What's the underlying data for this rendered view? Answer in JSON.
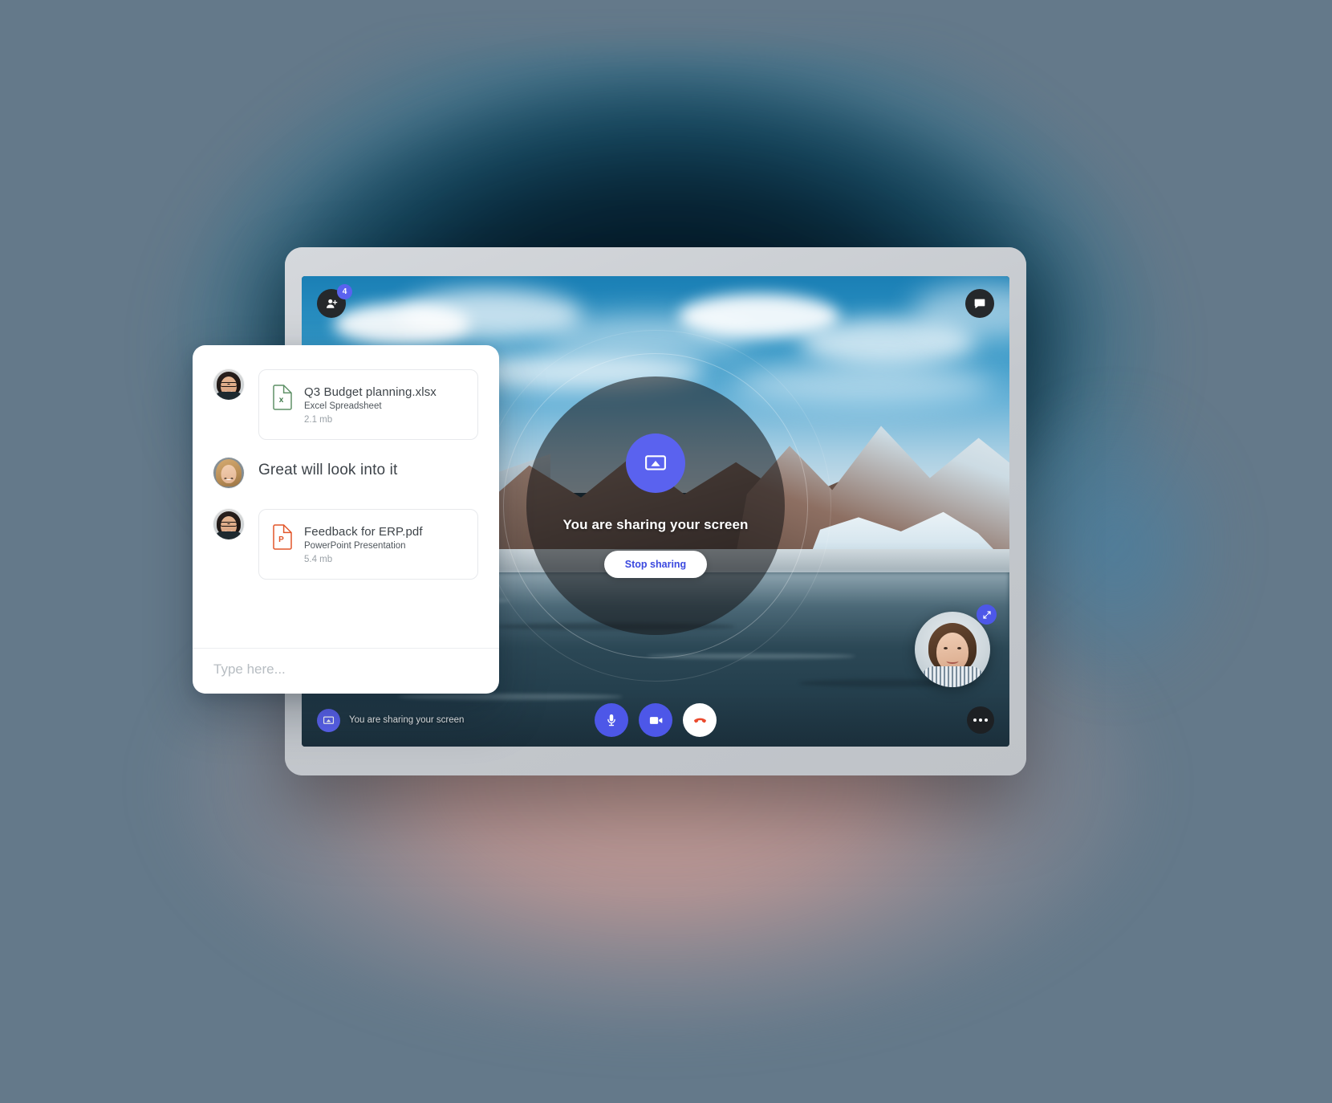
{
  "background": {
    "base_color": "#64798a",
    "teal_bloom": "#0a2a3c",
    "rose_bloom": "#c49c96"
  },
  "device": {
    "name": "tablet",
    "bezel_color": "#c9cdd1"
  },
  "call": {
    "wallpaper_alt": "Mountain lake landscape shared screen",
    "participants": {
      "icon": "add-person-icon",
      "badge_count": "4"
    },
    "chat_toggle_icon": "chat-bubble-icon",
    "share_overlay": {
      "cast_icon": "screen-cast-icon",
      "title": "You are sharing your screen",
      "stop_label": "Stop sharing",
      "accent_color": "#5a62ef",
      "stop_text_color": "#3b49df"
    },
    "selfview": {
      "label": "self-view",
      "expand_icon": "expand-icon",
      "expand_color": "#4d57e8"
    },
    "controlbar": {
      "status_icon": "screen-share-icon",
      "status_text": "You are sharing your screen",
      "buttons": [
        {
          "name": "microphone-button",
          "icon": "microphone-icon",
          "style": "blue"
        },
        {
          "name": "camera-button",
          "icon": "video-camera-icon",
          "style": "blue"
        },
        {
          "name": "end-call-button",
          "icon": "phone-hangup-icon",
          "style": "white"
        }
      ],
      "more_icon": "more-options-icon"
    }
  },
  "chat": {
    "messages": [
      {
        "kind": "file",
        "avatar": "woman-with-glasses-avatar",
        "avatar_style": "a",
        "file_icon": "excel-file-icon",
        "file_icon_color": "#4f8a5b",
        "name": "Q3 Budget planning.xlsx",
        "type": "Excel Spreadsheet",
        "size": "2.1 mb"
      },
      {
        "kind": "text",
        "avatar": "blonde-woman-avatar",
        "avatar_style": "b",
        "text": "Great will look into it"
      },
      {
        "kind": "file",
        "avatar": "woman-with-glasses-avatar",
        "avatar_style": "a",
        "file_icon": "powerpoint-file-icon",
        "file_icon_color": "#e2562a",
        "name": "Feedback for ERP.pdf",
        "type": "PowerPoint Presentation",
        "size": "5.4 mb"
      }
    ],
    "composer": {
      "placeholder": "Type here...",
      "value": ""
    }
  }
}
